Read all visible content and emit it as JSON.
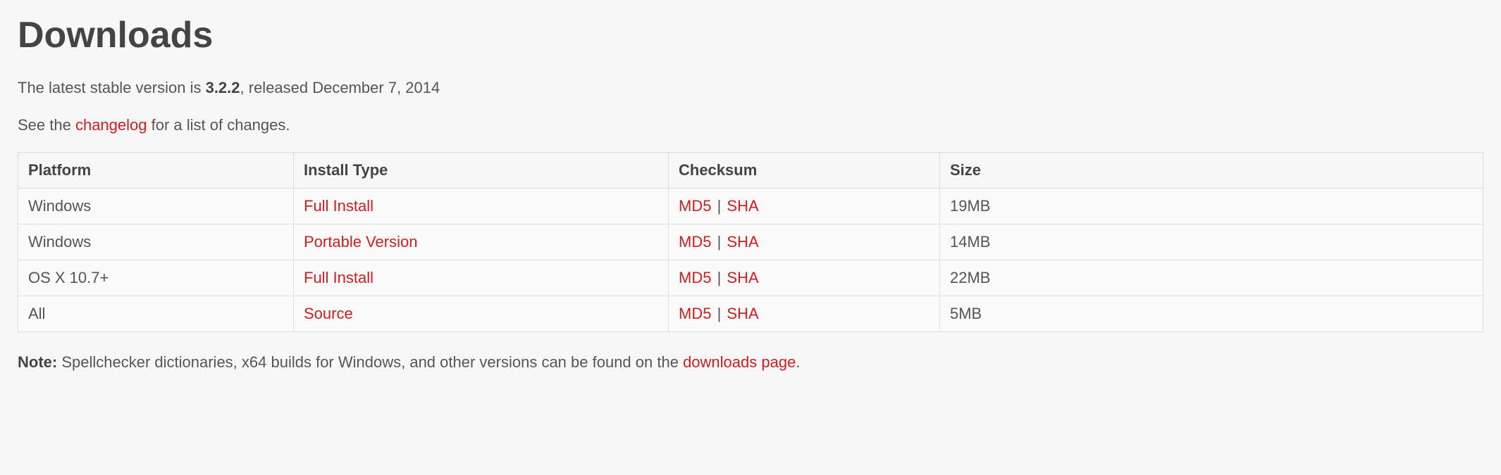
{
  "heading": "Downloads",
  "intro": {
    "prefix": "The latest stable version is ",
    "version": "3.2.2",
    "suffix": ", released December 7, 2014"
  },
  "changelog_line": {
    "prefix": "See the ",
    "link": "changelog",
    "suffix": " for a list of changes."
  },
  "table": {
    "headers": {
      "platform": "Platform",
      "install_type": "Install Type",
      "checksum": "Checksum",
      "size": "Size"
    },
    "checksum_labels": {
      "md5": "MD5",
      "sha": "SHA",
      "sep": " | "
    },
    "rows": [
      {
        "platform": "Windows",
        "install_type": "Full Install",
        "size": "19MB"
      },
      {
        "platform": "Windows",
        "install_type": "Portable Version",
        "size": "14MB"
      },
      {
        "platform": "OS X 10.7+",
        "install_type": "Full Install",
        "size": "22MB"
      },
      {
        "platform": "All",
        "install_type": "Source",
        "size": "5MB"
      }
    ]
  },
  "note": {
    "label": "Note:",
    "body_prefix": " Spellchecker dictionaries, x64 builds for Windows, and other versions can be found on the ",
    "link": "downloads page",
    "suffix": "."
  }
}
